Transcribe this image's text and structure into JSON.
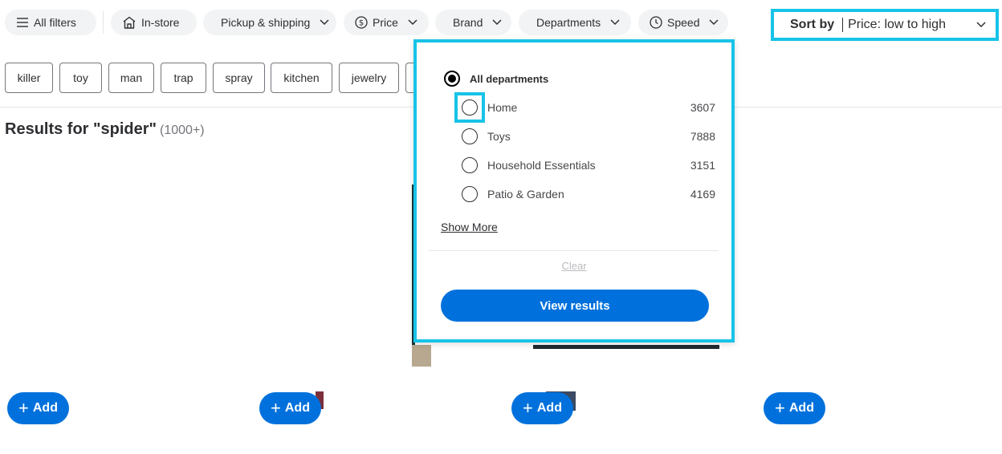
{
  "filters": {
    "all_filters": "All filters",
    "in_store": "In-store",
    "pickup": "Pickup & shipping",
    "price": "Price",
    "brand": "Brand",
    "departments": "Departments",
    "speed": "Speed"
  },
  "sort": {
    "label": "Sort by",
    "value": "Price: low to high"
  },
  "keywords": [
    "killer",
    "toy",
    "man",
    "trap",
    "spray",
    "kitchen",
    "jewelry"
  ],
  "results": {
    "title": "Results for \"spider\"",
    "count": "(1000+)"
  },
  "add_label": "Add",
  "departments_panel": {
    "all_label": "All departments",
    "options": [
      {
        "label": "Home",
        "count": "3607"
      },
      {
        "label": "Toys",
        "count": "7888"
      },
      {
        "label": "Household Essentials",
        "count": "3151"
      },
      {
        "label": "Patio & Garden",
        "count": "4169"
      }
    ],
    "show_more": "Show More",
    "clear": "Clear",
    "view_results": "View results"
  },
  "colors": {
    "accent_blue": "#0071dc",
    "highlight_cyan": "#17c3e8",
    "chip_bg": "#f2f3f4"
  }
}
